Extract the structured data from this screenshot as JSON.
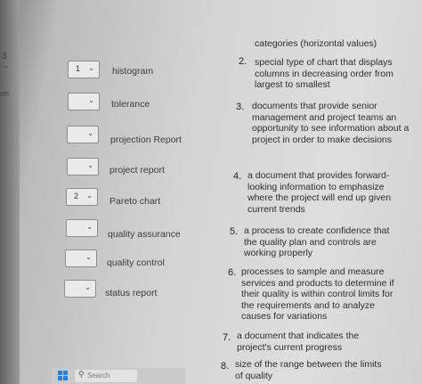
{
  "edge": {
    "number": "3",
    "dash": "--",
    "fragment": "on"
  },
  "header_fragment": "categories (horizontal values)",
  "terms": [
    {
      "label": "histogram",
      "selected": "1"
    },
    {
      "label": "tolerance",
      "selected": ""
    },
    {
      "label": "projection Report",
      "selected": ""
    },
    {
      "label": "project report",
      "selected": ""
    },
    {
      "label": "Pareto chart",
      "selected": "2"
    },
    {
      "label": "quality assurance",
      "selected": ""
    },
    {
      "label": "quality control",
      "selected": ""
    },
    {
      "label": "status report",
      "selected": ""
    }
  ],
  "definitions": [
    {
      "num": "2.",
      "text": "special type of chart that displays columns in decreasing order from largest to smallest"
    },
    {
      "num": "3.",
      "text": "documents that provide senior management and project teams an opportunity to see information about a project in order to make decisions"
    },
    {
      "num": "4.",
      "text": "a document that provides forward-looking information to emphasize where the project will end up given current trends"
    },
    {
      "num": "5.",
      "text": "a process to create confidence that the quality plan and controls are working properly"
    },
    {
      "num": "6.",
      "text": "processes to sample and measure services and products to determine if their quality is within control limits for the requirements and to analyze causes for variations"
    },
    {
      "num": "7.",
      "text": "a document that indicates the project's current progress"
    },
    {
      "num": "8.",
      "text": "size of the range between the limits of quality"
    }
  ],
  "taskbar": {
    "search_placeholder": "Search",
    "search_icon": "search-icon",
    "start_icon": "windows-icon"
  }
}
